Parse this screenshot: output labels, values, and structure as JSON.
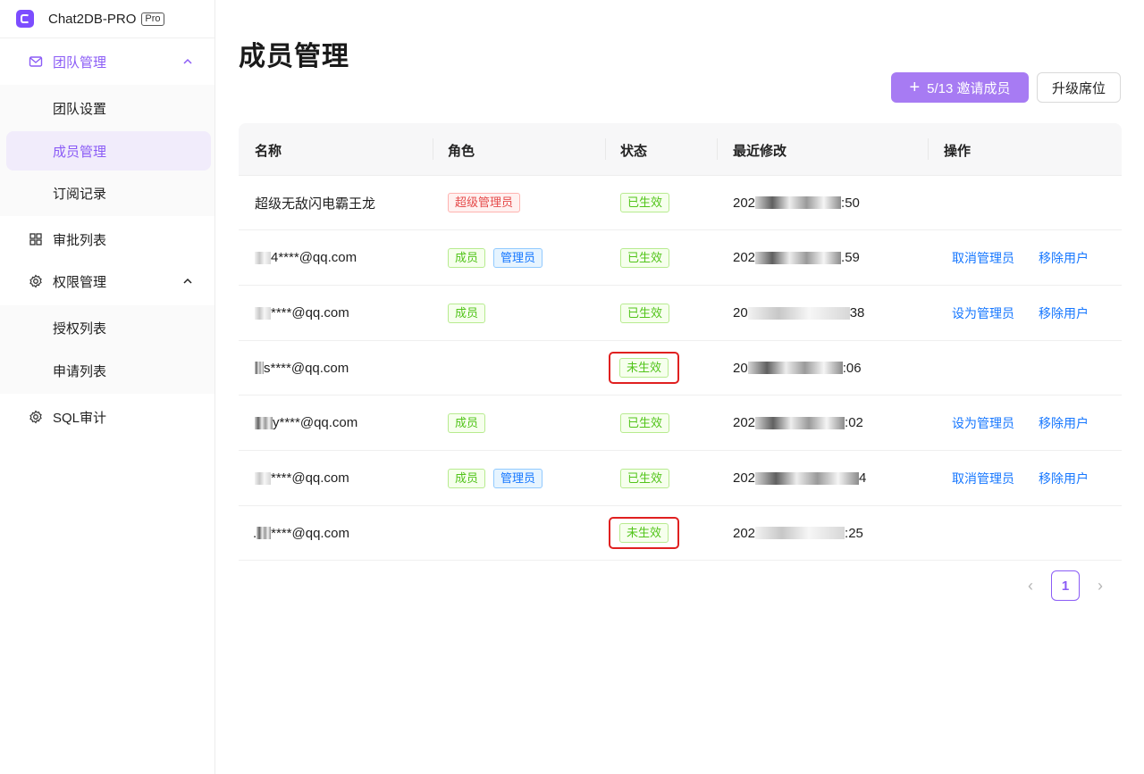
{
  "app": {
    "name": "Chat2DB-PRO",
    "badge": "Pro"
  },
  "sidebar": {
    "team_management": "团队管理",
    "team_items": [
      "团队设置",
      "成员管理",
      "订阅记录"
    ],
    "approval_list": "审批列表",
    "permission_management": "权限管理",
    "permission_items": [
      "授权列表",
      "申请列表"
    ],
    "sql_audit": "SQL审计"
  },
  "page": {
    "title": "成员管理"
  },
  "toolbar": {
    "invite_label": "5/13 邀请成员",
    "upgrade_label": "升级席位"
  },
  "table": {
    "columns": [
      "名称",
      "角色",
      "状态",
      "最近修改",
      "操作"
    ],
    "rows": [
      {
        "name_prefix": "",
        "name": "超级无敌闪电霸王龙",
        "roles": [
          "超级管理员"
        ],
        "status": "已生效",
        "modified_prefix": "202",
        "modified_suffix": ":50",
        "actions": []
      },
      {
        "name_prefix": "",
        "name": "4****@qq.com",
        "roles": [
          "成员",
          "管理员"
        ],
        "status": "已生效",
        "modified_prefix": "202",
        "modified_suffix": ".59",
        "actions": [
          "取消管理员",
          "移除用户"
        ]
      },
      {
        "name_prefix": "",
        "name": "****@qq.com",
        "roles": [
          "成员"
        ],
        "status": "已生效",
        "modified_prefix": "20",
        "modified_suffix": "38",
        "actions": [
          "设为管理员",
          "移除用户"
        ]
      },
      {
        "name_prefix": "",
        "name": "s****@qq.com",
        "roles": [],
        "status": "未生效",
        "modified_prefix": "20",
        "modified_suffix": ":06",
        "actions": []
      },
      {
        "name_prefix": "",
        "name": "y****@qq.com",
        "roles": [
          "成员"
        ],
        "status": "已生效",
        "modified_prefix": "202",
        "modified_suffix": ":02",
        "actions": [
          "设为管理员",
          "移除用户"
        ]
      },
      {
        "name_prefix": "",
        "name": "****@qq.com",
        "roles": [
          "成员",
          "管理员"
        ],
        "status": "已生效",
        "modified_prefix": "202",
        "modified_suffix": "4",
        "actions": [
          "取消管理员",
          "移除用户"
        ]
      },
      {
        "name_prefix": ".",
        "name": "****@qq.com",
        "roles": [],
        "status": "未生效",
        "modified_prefix": "202",
        "modified_suffix": ":25",
        "actions": []
      }
    ]
  },
  "pagination": {
    "current": "1"
  }
}
